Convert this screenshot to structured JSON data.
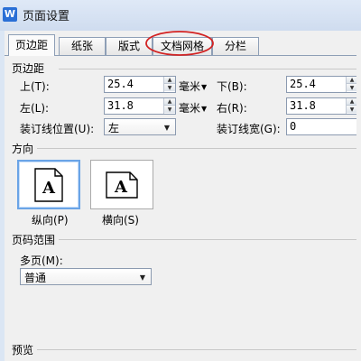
{
  "window": {
    "title": "页面设置",
    "app_icon_letter": "W"
  },
  "tabs": [
    {
      "label": "页边距",
      "active": true
    },
    {
      "label": "纸张",
      "active": false
    },
    {
      "label": "版式",
      "active": false
    },
    {
      "label": "文档网格",
      "active": false,
      "highlighted": true
    },
    {
      "label": "分栏",
      "active": false
    }
  ],
  "margins": {
    "section_title": "页边距",
    "top": {
      "label": "上(T):",
      "value": "25.4",
      "unit": "毫米"
    },
    "bottom": {
      "label": "下(B):",
      "value": "25.4"
    },
    "left": {
      "label": "左(L):",
      "value": "31.8",
      "unit": "毫米"
    },
    "right": {
      "label": "右(R):",
      "value": "31.8"
    },
    "gutter_position": {
      "label": "装订线位置(U):",
      "value": "左"
    },
    "gutter_width": {
      "label": "装订线宽(G):",
      "value": "0"
    }
  },
  "orientation": {
    "section_title": "方向",
    "portrait": {
      "label": "纵向(P)",
      "glyph": "A",
      "selected": true
    },
    "landscape": {
      "label": "横向(S)",
      "glyph": "A",
      "selected": false
    }
  },
  "page_range": {
    "section_title": "页码范围",
    "multiple_pages_label": "多页(M):",
    "multiple_pages_value": "普通"
  },
  "preview": {
    "section_title": "预览"
  },
  "colors": {
    "highlight_ellipse": "#d22222",
    "selected_border": "#6aa4e6"
  }
}
